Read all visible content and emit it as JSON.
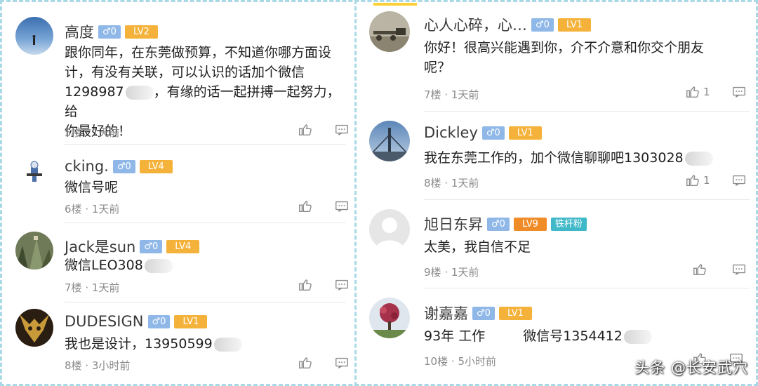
{
  "left_comments": [
    {
      "name": "高度",
      "gender": "♂0",
      "level": "LV2",
      "lines": [
        "跟你同年，在东莞做预算，不知道你哪方面设",
        "计，有没有关联，可以认识的话加个微信",
        "1298987",
        "，有缘的话一起拼搏一起努力，给",
        "你最好的！"
      ],
      "floor": "5楼",
      "time": "1天前"
    },
    {
      "name": "cking.",
      "gender": "♂0",
      "level": "LV4",
      "lines": [
        "微信号呢"
      ],
      "floor": "6楼",
      "time": "1天前"
    },
    {
      "name": "Jack是sun",
      "gender": "♂0",
      "level": "LV4",
      "lines": [
        "微信LEO308"
      ],
      "floor": "7楼",
      "time": "1天前"
    },
    {
      "name": "DUDESIGN",
      "gender": "♂0",
      "level": "LV1",
      "lines": [
        "我也是设计，13950599"
      ],
      "floor": "8楼",
      "time": "3小时前"
    }
  ],
  "right_comments": [
    {
      "name": "心人心碎，心…",
      "gender": "♂0",
      "level": "LV1",
      "lines": [
        "你好！很高兴能遇到你，介不介意和你交个朋友",
        "呢？"
      ],
      "floor": "7楼",
      "time": "1天前",
      "likes": "1"
    },
    {
      "name": "Dickley",
      "gender": "♂0",
      "level": "LV1",
      "lines": [
        "我在东莞工作的，加个微信聊聊吧1303028"
      ],
      "floor": "8楼",
      "time": "1天前",
      "likes": "1"
    },
    {
      "name": "旭日东昇",
      "gender": "♂0",
      "level": "LV9",
      "fan_badge": "铁杆粉",
      "lines": [
        "太美，我自信不足"
      ],
      "floor": "9楼",
      "time": "1天前",
      "likes": ""
    },
    {
      "name": "谢嘉嘉",
      "gender": "♂0",
      "level": "LV1",
      "lines": [
        "93年 工作",
        "微信号1354412"
      ],
      "floor": "10楼",
      "time": "5小时前",
      "likes": ""
    }
  ],
  "meta_separator": "·",
  "watermark": "头条 @长安武穴",
  "icons": {
    "like": "thumbs-up-icon",
    "reply": "comment-bubble-icon"
  },
  "colors": {
    "gender_badge": "#8fb8e8",
    "level_badge": "#f4b23a",
    "level_badge_high": "#f08c28",
    "fan_badge": "#3fb8c8",
    "border": "#a9d8e6"
  }
}
